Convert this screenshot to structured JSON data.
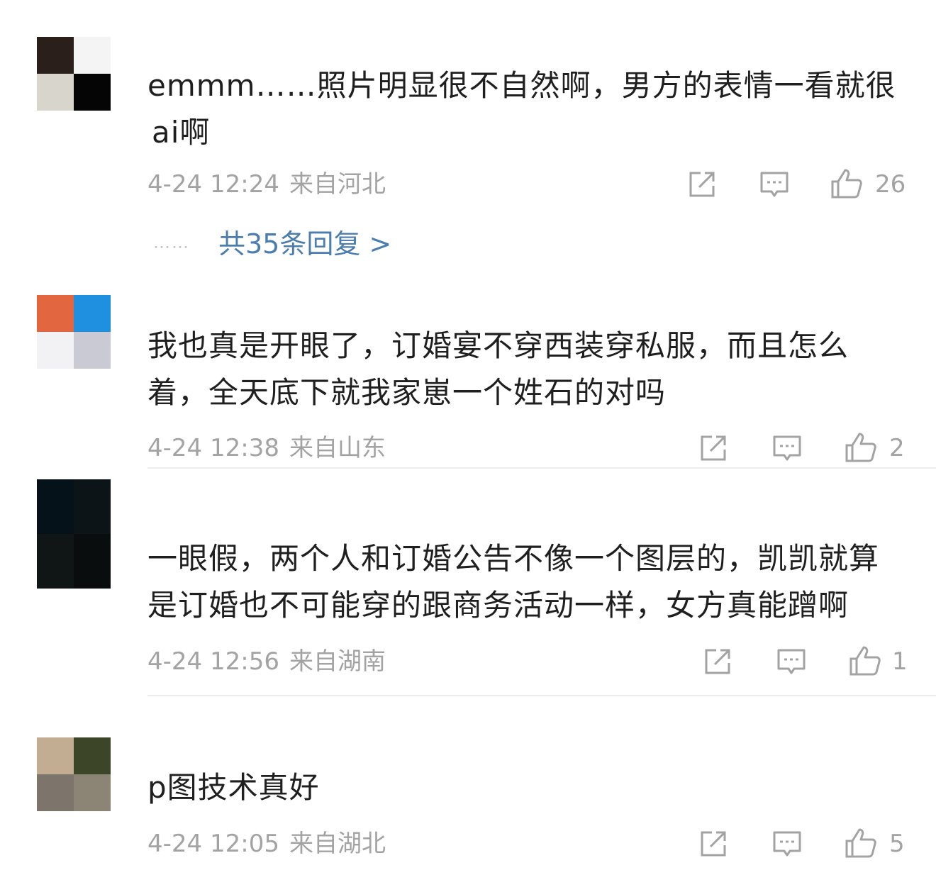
{
  "comments": [
    {
      "text_line1": "emmm……照片明显很不自然啊，男方的表情一看就很",
      "text_line2": "ai啊",
      "date": "4-24 12:24",
      "location": "来自河北",
      "likes": "26",
      "avatar_colors": [
        "#2a1f1a",
        "#f4f4f4",
        "#d8d6cc",
        "#050505"
      ]
    },
    {
      "text_line1": "我也真是开眼了，订婚宴不穿西装穿私服，而且怎么",
      "text_line2": "着，全天底下就我家崽一个姓石的对吗",
      "date": "4-24 12:38",
      "location": "来自山东",
      "likes": "2",
      "avatar_colors": [
        "#e2663f",
        "#1f8fe0",
        "#f2f2f4",
        "#c9cad4"
      ]
    },
    {
      "text_line1": "一眼假，两个人和订婚公告不像一个图层的，凯凯就算",
      "text_line2": "是订婚也不可能穿的跟商务活动一样，女方真能蹭啊",
      "date": "4-24 12:56",
      "location": "来自湖南",
      "likes": "1",
      "avatar_colors": [
        "#06121a",
        "#0c1418",
        "#101616",
        "#0a0d0e"
      ]
    },
    {
      "text_line1": "p图技术真好",
      "text_line2": "",
      "date": "4-24 12:05",
      "location": "来自湖北",
      "likes": "5",
      "avatar_colors": [
        "#c2ad93",
        "#3d4528",
        "#7d756c",
        "#8c8474"
      ]
    }
  ],
  "replies": {
    "dots": "……",
    "label": "共35条回复 >"
  },
  "icons": {
    "share": "share-icon",
    "comment": "comment-icon",
    "like": "thumbs-up-icon"
  },
  "colors": {
    "text": "#1f1f1f",
    "meta": "#a3a3a3",
    "link": "#4b7eb0"
  }
}
